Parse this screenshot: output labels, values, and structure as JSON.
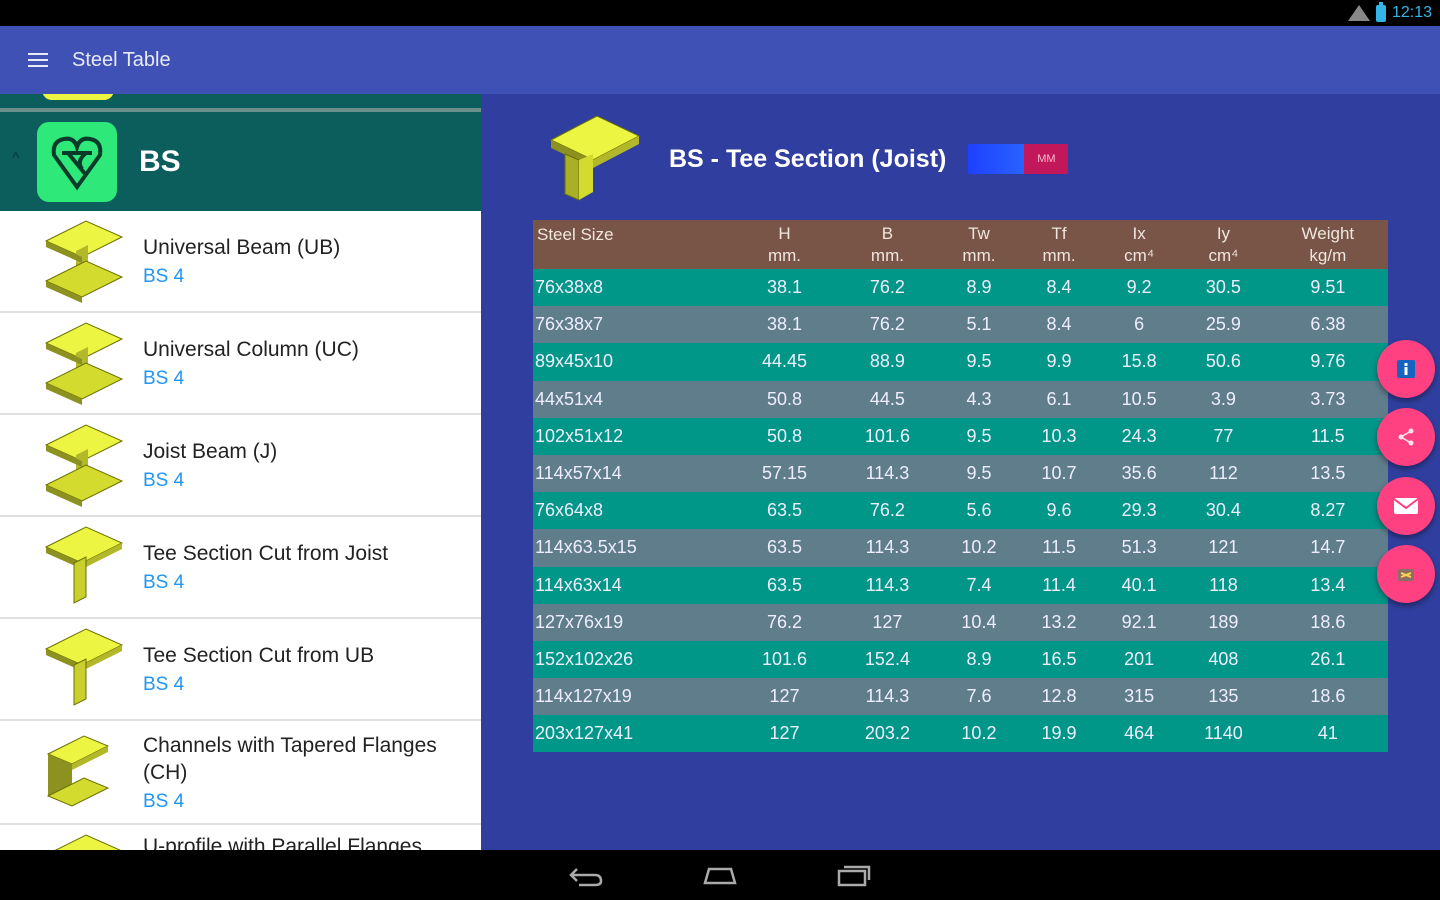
{
  "status_bar": {
    "time": "12:13"
  },
  "app_bar": {
    "title": "Steel Table"
  },
  "sidebar": {
    "group": {
      "title": "BS"
    },
    "items": [
      {
        "label": "Universal Beam (UB)",
        "sub": "BS 4"
      },
      {
        "label": "Universal Column (UC)",
        "sub": "BS 4"
      },
      {
        "label": "Joist Beam (J)",
        "sub": "BS 4"
      },
      {
        "label": "Tee Section Cut from Joist",
        "sub": "BS 4"
      },
      {
        "label": "Tee Section Cut from UB",
        "sub": "BS 4"
      },
      {
        "label": "Channels with Tapered Flanges (CH)",
        "sub": "BS 4"
      },
      {
        "label": "U-profile with Parallel Flanges",
        "sub": ""
      }
    ]
  },
  "main": {
    "title": "BS - Tee Section (Joist)",
    "unit_label": "MM",
    "columns": [
      {
        "line1": "Steel Size",
        "line2": ""
      },
      {
        "line1": "H",
        "line2": "mm."
      },
      {
        "line1": "B",
        "line2": "mm."
      },
      {
        "line1": "Tw",
        "line2": "mm."
      },
      {
        "line1": "Tf",
        "line2": "mm."
      },
      {
        "line1": "Ix",
        "line2": "cm⁴"
      },
      {
        "line1": "Iy",
        "line2": "cm⁴"
      },
      {
        "line1": "Weight",
        "line2": "kg/m"
      }
    ],
    "rows": [
      [
        "76x38x8",
        "38.1",
        "76.2",
        "8.9",
        "8.4",
        "9.2",
        "30.5",
        "9.51"
      ],
      [
        "76x38x7",
        "38.1",
        "76.2",
        "5.1",
        "8.4",
        "6",
        "25.9",
        "6.38"
      ],
      [
        "89x45x10",
        "44.45",
        "88.9",
        "9.5",
        "9.9",
        "15.8",
        "50.6",
        "9.76"
      ],
      [
        "44x51x4",
        "50.8",
        "44.5",
        "4.3",
        "6.1",
        "10.5",
        "3.9",
        "3.73"
      ],
      [
        "102x51x12",
        "50.8",
        "101.6",
        "9.5",
        "10.3",
        "24.3",
        "77",
        "11.5"
      ],
      [
        "114x57x14",
        "57.15",
        "114.3",
        "9.5",
        "10.7",
        "35.6",
        "112",
        "13.5"
      ],
      [
        "76x64x8",
        "63.5",
        "76.2",
        "5.6",
        "9.6",
        "29.3",
        "30.4",
        "8.27"
      ],
      [
        "114x63.5x15",
        "63.5",
        "114.3",
        "10.2",
        "11.5",
        "51.3",
        "121",
        "14.7"
      ],
      [
        "114x63x14",
        "63.5",
        "114.3",
        "7.4",
        "11.4",
        "40.1",
        "118",
        "13.4"
      ],
      [
        "127x76x19",
        "76.2",
        "127",
        "10.4",
        "13.2",
        "92.1",
        "189",
        "18.6"
      ],
      [
        "152x102x26",
        "101.6",
        "152.4",
        "8.9",
        "16.5",
        "201",
        "408",
        "26.1"
      ],
      [
        "114x127x19",
        "127",
        "114.3",
        "7.6",
        "12.8",
        "315",
        "135",
        "18.6"
      ],
      [
        "203x127x41",
        "127",
        "203.2",
        "10.2",
        "19.9",
        "464",
        "1140",
        "41"
      ]
    ]
  },
  "fabs": [
    "info-icon",
    "share-icon",
    "mail-icon",
    "pdf-icon"
  ],
  "colors": {
    "app_bar": "#3f51b5",
    "group_header": "#0b5e5c",
    "main_bg": "#303f9f",
    "table_header": "#795548",
    "row_odd": "#009688",
    "row_even": "#607d8b",
    "fab": "#ff4081",
    "link": "#2196f3"
  }
}
